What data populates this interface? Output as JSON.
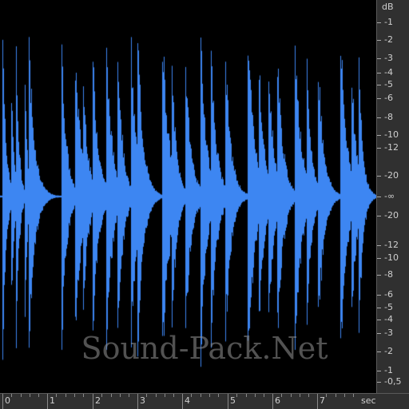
{
  "colors": {
    "waveform": "#3d86f2",
    "background": "#000000",
    "ruler_bg": "#303030",
    "ruler_text": "#cfcfcf"
  },
  "db_scale": {
    "unit": "dB",
    "labels": [
      "-1",
      "-2",
      "-3",
      "-4",
      "-5",
      "-6",
      "-8",
      "-10",
      "-12",
      "-20",
      "-∞",
      "-20",
      "-12",
      "-10",
      "-8",
      "-6",
      "-5",
      "-4",
      "-3",
      "-2",
      "-1",
      "-0,5"
    ]
  },
  "time_scale": {
    "unit": "sec",
    "labels": [
      "0",
      "1",
      "2",
      "3",
      "4",
      "5",
      "6",
      "7"
    ]
  },
  "watermark": "Sound-Pack.Net",
  "waveform": {
    "duration_sec": 8.2,
    "hits": [
      {
        "t": 0.0,
        "amp": 1.0,
        "decay": 0.2
      },
      {
        "t": 0.18,
        "amp": 0.8,
        "decay": 0.18
      },
      {
        "t": 0.3,
        "amp": 0.85,
        "decay": 0.18
      },
      {
        "t": 0.48,
        "amp": 1.0,
        "decay": 0.15
      },
      {
        "t": 0.58,
        "amp": 0.95,
        "decay": 0.35
      },
      {
        "t": 1.3,
        "amp": 1.0,
        "decay": 0.3
      },
      {
        "t": 1.6,
        "amp": 0.9,
        "decay": 0.4
      },
      {
        "t": 1.78,
        "amp": 0.8,
        "decay": 0.3
      },
      {
        "t": 2.0,
        "amp": 0.85,
        "decay": 0.35
      },
      {
        "t": 2.3,
        "amp": 0.95,
        "decay": 0.35
      },
      {
        "t": 2.55,
        "amp": 1.0,
        "decay": 0.3
      },
      {
        "t": 2.85,
        "amp": 0.9,
        "decay": 0.35
      },
      {
        "t": 3.0,
        "amp": 0.95,
        "decay": 0.35
      },
      {
        "t": 3.55,
        "amp": 1.0,
        "decay": 0.4
      },
      {
        "t": 3.75,
        "amp": 0.85,
        "decay": 0.3
      },
      {
        "t": 4.05,
        "amp": 0.9,
        "decay": 0.35
      },
      {
        "t": 4.4,
        "amp": 1.0,
        "decay": 0.35
      },
      {
        "t": 4.62,
        "amp": 0.95,
        "decay": 0.35
      },
      {
        "t": 4.95,
        "amp": 0.85,
        "decay": 0.35
      },
      {
        "t": 5.45,
        "amp": 1.0,
        "decay": 0.4
      },
      {
        "t": 5.7,
        "amp": 0.85,
        "decay": 0.3
      },
      {
        "t": 5.9,
        "amp": 0.95,
        "decay": 0.3
      },
      {
        "t": 6.1,
        "amp": 0.9,
        "decay": 0.35
      },
      {
        "t": 6.5,
        "amp": 1.0,
        "decay": 0.35
      },
      {
        "t": 6.75,
        "amp": 0.85,
        "decay": 0.3
      },
      {
        "t": 7.0,
        "amp": 0.9,
        "decay": 0.35
      },
      {
        "t": 7.5,
        "amp": 1.0,
        "decay": 0.4
      },
      {
        "t": 7.75,
        "amp": 0.85,
        "decay": 0.3
      },
      {
        "t": 7.92,
        "amp": 0.8,
        "decay": 0.25
      }
    ]
  }
}
